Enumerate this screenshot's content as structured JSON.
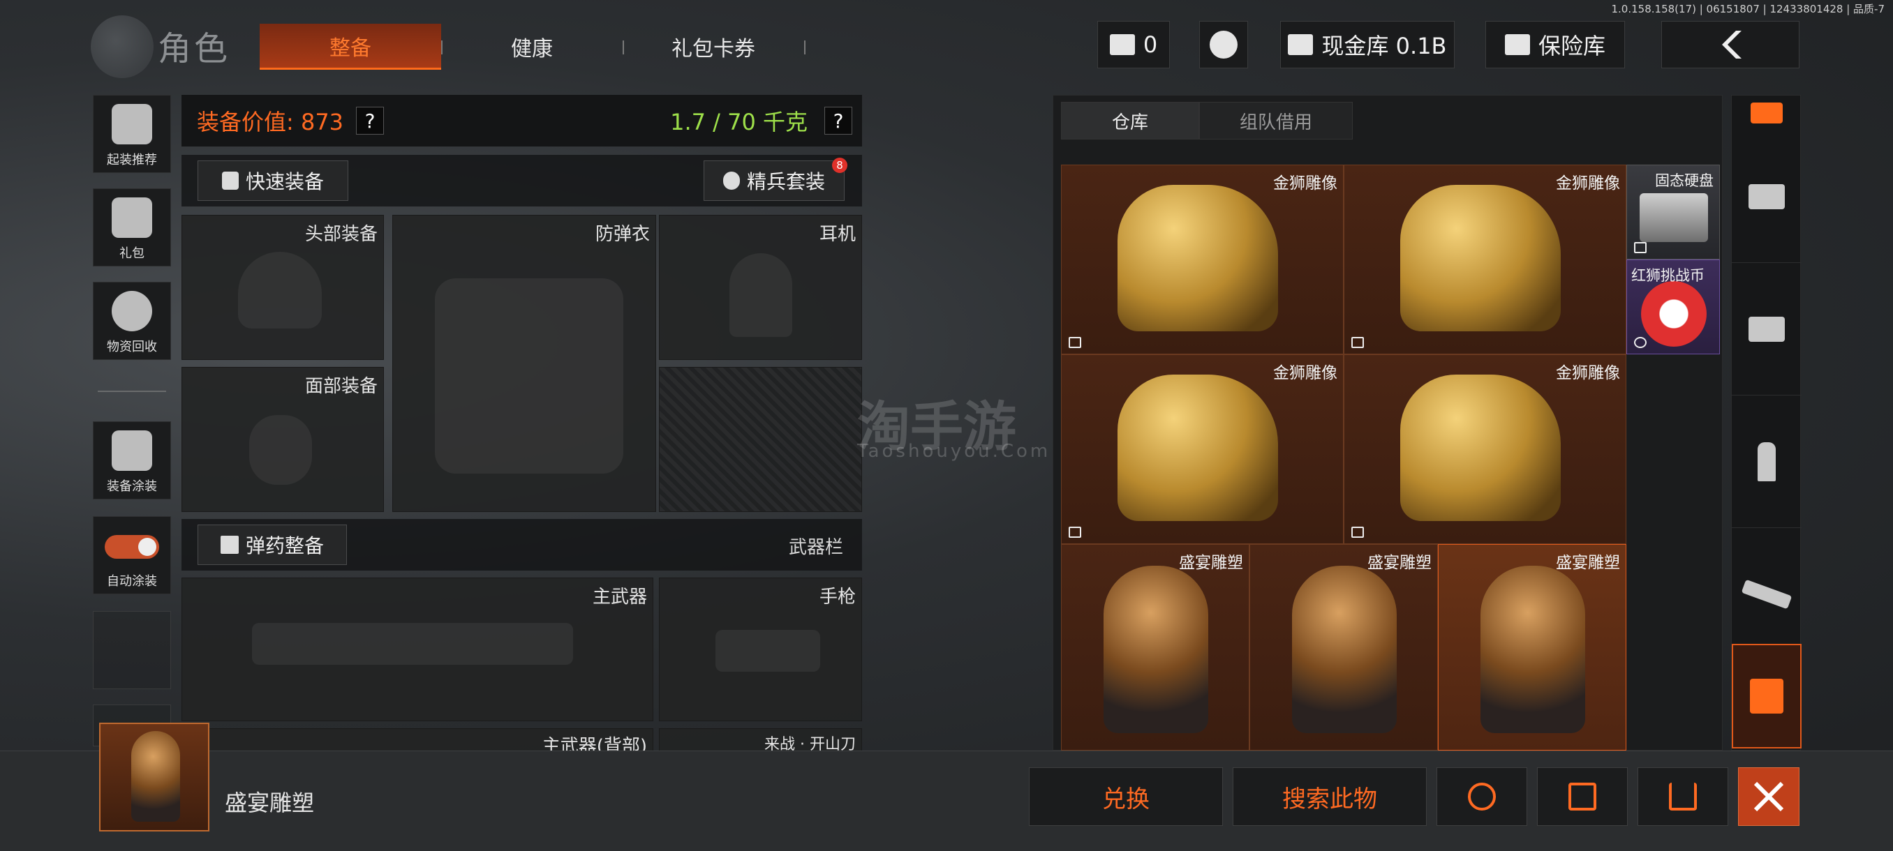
{
  "version": "1.0.158.158(17) | 06151807 | 12433801428 | 品质-7",
  "top": {
    "title": "角色",
    "tabs": [
      {
        "label": "整备",
        "active": true
      },
      {
        "label": "健康",
        "active": false
      },
      {
        "label": "礼包卡券",
        "active": false
      }
    ],
    "currency_value": "0",
    "vault_label": "现金库 0.1B",
    "insurance_label": "保险库"
  },
  "sidebar": {
    "items": [
      {
        "label": "起装推荐",
        "icon": "helmet-recommend-icon"
      },
      {
        "label": "礼包",
        "icon": "gift-icon"
      },
      {
        "label": "物资回收",
        "icon": "recycle-icon"
      },
      {
        "label": "装备涂装",
        "icon": "paint-helmet-icon"
      },
      {
        "label": "自动涂装",
        "icon": "toggle-icon"
      }
    ]
  },
  "equipment": {
    "value_label": "装备价值: 873",
    "weight_label": "1.7 / 70 千克",
    "help": "?",
    "quick_equip": "快速装备",
    "elite_set": "精兵套装",
    "elite_badge": "8",
    "slots": {
      "head": "头部装备",
      "armor": "防弹衣",
      "headset": "耳机",
      "face": "面部装备",
      "ammo_button": "弹药整备",
      "weapon_bar": "武器栏",
      "primary": "主武器",
      "pistol": "手枪",
      "primary_back": "主武器(背部)",
      "melee": "来战 · 开山刀"
    }
  },
  "inventory": {
    "tabs": [
      {
        "label": "仓库",
        "active": true
      },
      {
        "label": "组队借用",
        "active": false
      }
    ],
    "items": [
      {
        "label": "金狮雕像"
      },
      {
        "label": "金狮雕像"
      },
      {
        "label": "固态硬盘"
      },
      {
        "label": "红狮挑战币"
      },
      {
        "label": "金狮雕像"
      },
      {
        "label": "金狮雕像"
      },
      {
        "label": "盛宴雕塑"
      },
      {
        "label": "盛宴雕塑"
      },
      {
        "label": "盛宴雕塑"
      }
    ]
  },
  "selected": {
    "name": "盛宴雕塑"
  },
  "actions": {
    "exchange": "兑换",
    "search_item": "搜索此物"
  },
  "watermark": {
    "main": "淘手游",
    "sub": "Taoshouyou.Com"
  },
  "colors": {
    "accent": "#ff6a22",
    "weight": "#9ee04a",
    "item_bg": "#4a2514"
  }
}
